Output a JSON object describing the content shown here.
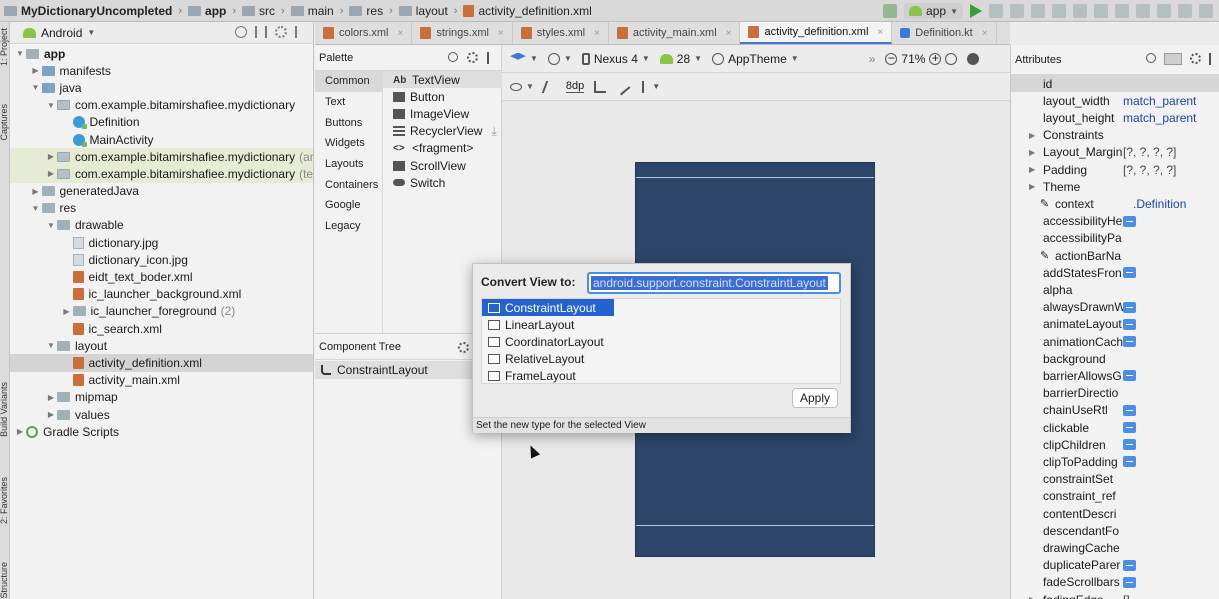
{
  "breadcrumb": [
    "MyDictionaryUncompleted",
    "app",
    "src",
    "main",
    "res",
    "layout",
    "activity_definition.xml"
  ],
  "top_right": {
    "run_config": "app"
  },
  "left_strip": {
    "labels": [
      "1: Project",
      "Captures",
      "Build Variants",
      "2: Favorites",
      "Structure"
    ]
  },
  "project": {
    "view_mode": "Android",
    "tree": [
      {
        "label": "app",
        "indent": 0,
        "arrow": "▼",
        "icon": "folder",
        "bold": true
      },
      {
        "label": "manifests",
        "indent": 1,
        "arrow": "▶",
        "icon": "folder-blue"
      },
      {
        "label": "java",
        "indent": 1,
        "arrow": "▼",
        "icon": "folder-blue"
      },
      {
        "label": "com.example.bitamirshafiee.mydictionary",
        "indent": 2,
        "arrow": "▼",
        "icon": "package"
      },
      {
        "label": "Definition",
        "indent": 3,
        "arrow": "",
        "icon": "class"
      },
      {
        "label": "MainActivity",
        "indent": 3,
        "arrow": "",
        "icon": "class"
      },
      {
        "label": "com.example.bitamirshafiee.mydictionary",
        "suffix": "(ar",
        "indent": 2,
        "arrow": "▶",
        "icon": "package",
        "hl": true
      },
      {
        "label": "com.example.bitamirshafiee.mydictionary",
        "suffix": "(te",
        "indent": 2,
        "arrow": "▶",
        "icon": "package",
        "hl": true
      },
      {
        "label": "generatedJava",
        "indent": 1,
        "arrow": "▶",
        "icon": "folder"
      },
      {
        "label": "res",
        "indent": 1,
        "arrow": "▼",
        "icon": "folder"
      },
      {
        "label": "drawable",
        "indent": 2,
        "arrow": "▼",
        "icon": "folder"
      },
      {
        "label": "dictionary.jpg",
        "indent": 3,
        "arrow": "",
        "icon": "image"
      },
      {
        "label": "dictionary_icon.jpg",
        "indent": 3,
        "arrow": "",
        "icon": "image"
      },
      {
        "label": "eidt_text_boder.xml",
        "indent": 3,
        "arrow": "",
        "icon": "xml"
      },
      {
        "label": "ic_launcher_background.xml",
        "indent": 3,
        "arrow": "",
        "icon": "xml"
      },
      {
        "label": "ic_launcher_foreground",
        "suffix": "(2)",
        "indent": 3,
        "arrow": "▶",
        "icon": "folder"
      },
      {
        "label": "ic_search.xml",
        "indent": 3,
        "arrow": "",
        "icon": "xml"
      },
      {
        "label": "layout",
        "indent": 2,
        "arrow": "▼",
        "icon": "folder"
      },
      {
        "label": "activity_definition.xml",
        "indent": 3,
        "arrow": "",
        "icon": "xml",
        "selected": true
      },
      {
        "label": "activity_main.xml",
        "indent": 3,
        "arrow": "",
        "icon": "xml"
      },
      {
        "label": "mipmap",
        "indent": 2,
        "arrow": "▶",
        "icon": "folder"
      },
      {
        "label": "values",
        "indent": 2,
        "arrow": "▶",
        "icon": "folder"
      },
      {
        "label": "Gradle Scripts",
        "indent": 0,
        "arrow": "▶",
        "icon": "gradle"
      }
    ]
  },
  "tabs": [
    {
      "label": "colors.xml",
      "icon": "xml"
    },
    {
      "label": "strings.xml",
      "icon": "xml"
    },
    {
      "label": "styles.xml",
      "icon": "xml"
    },
    {
      "label": "activity_main.xml",
      "icon": "xml"
    },
    {
      "label": "activity_definition.xml",
      "icon": "xml",
      "active": true
    },
    {
      "label": "Definition.kt",
      "icon": "kotlin"
    }
  ],
  "palette": {
    "title": "Palette",
    "categories": [
      "Common",
      "Text",
      "Buttons",
      "Widgets",
      "Layouts",
      "Containers",
      "Google",
      "Legacy"
    ],
    "active_category": "Common",
    "items": [
      {
        "label": "TextView",
        "icon": "Ab",
        "active": true
      },
      {
        "label": "Button",
        "icon": "button"
      },
      {
        "label": "ImageView",
        "icon": "image"
      },
      {
        "label": "RecyclerView",
        "icon": "list"
      },
      {
        "label": "<fragment>",
        "icon": "<>"
      },
      {
        "label": "ScrollView",
        "icon": "scroll"
      },
      {
        "label": "Switch",
        "icon": "switch"
      }
    ]
  },
  "component_tree": {
    "title": "Component Tree",
    "root": "ConstraintLayout"
  },
  "design_toolbar": {
    "device": "Nexus 4",
    "api": "28",
    "theme": "AppTheme",
    "zoom": "71%",
    "margin": "8dp"
  },
  "attributes": {
    "title": "Attributes",
    "rows": [
      {
        "name": "id",
        "value": "",
        "kind": "id"
      },
      {
        "name": "layout_width",
        "value": "match_parent"
      },
      {
        "name": "layout_height",
        "value": "match_parent"
      },
      {
        "name": "Constraints",
        "value": "",
        "arrow": true
      },
      {
        "name": "Layout_Margin",
        "value": "[?, ?, ?, ?]",
        "arrow": true,
        "gray": true
      },
      {
        "name": "Padding",
        "value": "[?, ?, ?, ?]",
        "arrow": true,
        "gray": true
      },
      {
        "name": "Theme",
        "value": "",
        "arrow": true
      },
      {
        "name": "context",
        "value": ".Definition",
        "pen": true
      },
      {
        "name": "accessibilityHe",
        "value": "",
        "minus": true
      },
      {
        "name": "accessibilityPa",
        "value": ""
      },
      {
        "name": "actionBarNa",
        "value": "",
        "pen": true
      },
      {
        "name": "addStatesFron",
        "value": "",
        "minus": true
      },
      {
        "name": "alpha",
        "value": ""
      },
      {
        "name": "alwaysDrawnW",
        "value": "",
        "minus": true
      },
      {
        "name": "animateLayout",
        "value": "",
        "minus": true
      },
      {
        "name": "animationCach",
        "value": "",
        "minus": true
      },
      {
        "name": "background",
        "value": ""
      },
      {
        "name": "barrierAllowsG",
        "value": "",
        "minus": true
      },
      {
        "name": "barrierDirectio",
        "value": ""
      },
      {
        "name": "chainUseRtl",
        "value": "",
        "minus": true
      },
      {
        "name": "clickable",
        "value": "",
        "minus": true
      },
      {
        "name": "clipChildren",
        "value": "",
        "minus": true
      },
      {
        "name": "clipToPadding",
        "value": "",
        "minus": true
      },
      {
        "name": "constraintSet",
        "value": ""
      },
      {
        "name": "constraint_ref",
        "value": ""
      },
      {
        "name": "contentDescri",
        "value": ""
      },
      {
        "name": "descendantFo",
        "value": ""
      },
      {
        "name": "drawingCache",
        "value": ""
      },
      {
        "name": "duplicateParer",
        "value": "",
        "minus": true
      },
      {
        "name": "fadeScrollbars",
        "value": "",
        "minus": true
      },
      {
        "name": "fadingEdge",
        "value": "[]",
        "arrow": true,
        "gray": true
      }
    ]
  },
  "dialog": {
    "title": "Convert View to:",
    "input_value": "android.support.constraint.ConstraintLayout",
    "options": [
      "ConstraintLayout",
      "LinearLayout",
      "CoordinatorLayout",
      "RelativeLayout",
      "FrameLayout"
    ],
    "selected_option": "ConstraintLayout",
    "apply_label": "Apply",
    "footer": "Set the new type for the selected View"
  },
  "colors": {
    "accent": "#2463cf",
    "blueprint": "#2c4569",
    "link": "#1c44aa"
  }
}
